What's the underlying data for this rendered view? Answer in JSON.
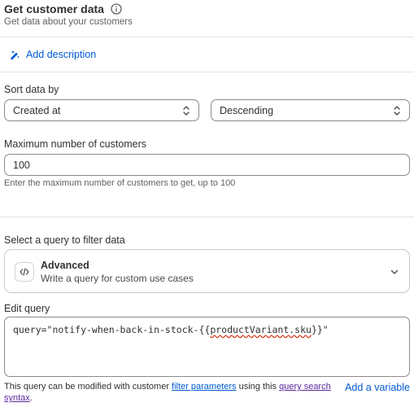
{
  "header": {
    "title": "Get customer data",
    "subtitle": "Get data about your customers"
  },
  "add_description": {
    "label": "Add description"
  },
  "sort": {
    "label": "Sort data by",
    "field_value": "Created at",
    "order_value": "Descending"
  },
  "max_customers": {
    "label": "Maximum number of customers",
    "value": "100",
    "help": "Enter the maximum number of customers to get, up to 100"
  },
  "filter": {
    "label": "Select a query to filter data",
    "option_title": "Advanced",
    "option_desc": "Write a query for custom use cases"
  },
  "edit_query": {
    "label": "Edit query",
    "prefix": "query=\"notify-when-back-in-stock-{{",
    "variable": "productVariant.sku",
    "suffix": "}}\""
  },
  "footer": {
    "help_prefix": "This query can be modified with customer ",
    "filter_link": "filter parameters",
    "help_middle": " using this ",
    "syntax_link": "query search syntax",
    "help_suffix": ".",
    "add_variable": "Add a variable"
  },
  "colors": {
    "link": "#005bd3",
    "visited_link": "#5c2a9d",
    "text": "#303030",
    "muted": "#616161",
    "spellcheck": "#d72c0d"
  },
  "icons": {
    "info": "info-icon",
    "add_description": "sparkle-edit-icon",
    "select": "chevron-up-down-icon",
    "code": "code-icon",
    "dropdown": "chevron-down-icon"
  }
}
